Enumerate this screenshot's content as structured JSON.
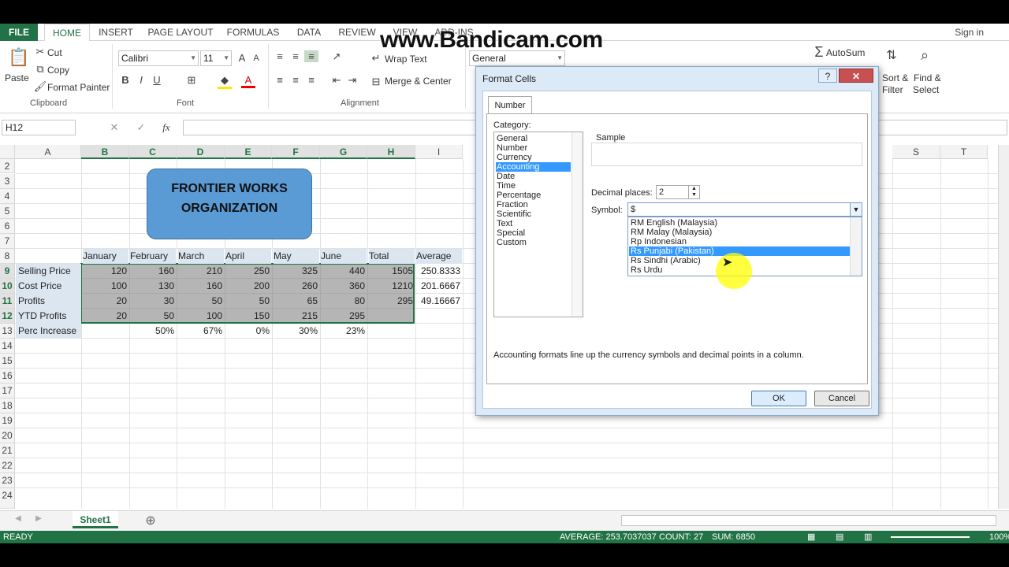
{
  "watermark": "www.Bandicam.com",
  "tabs": [
    "FILE",
    "HOME",
    "INSERT",
    "PAGE LAYOUT",
    "FORMULAS",
    "DATA",
    "REVIEW",
    "VIEW",
    "ADD-INS"
  ],
  "signin": "Sign in",
  "ribbon": {
    "paste": "Paste",
    "cut": "Cut",
    "copy": "Copy",
    "format_painter": "Format Painter",
    "clipboard": "Clipboard",
    "font_name": "Calibri",
    "font_size": "11",
    "font_group": "Font",
    "wrap_text": "Wrap Text",
    "merge_center": "Merge & Center",
    "alignment": "Alignment",
    "number_format": "General",
    "autosum": "AutoSum",
    "sort_filter": "Sort &",
    "sort_filter2": "Filter",
    "find_select": "Find &",
    "find_select2": "Select"
  },
  "namebox": "H12",
  "columns": [
    "A",
    "B",
    "C",
    "D",
    "E",
    "F",
    "G",
    "H",
    "I",
    "S",
    "T"
  ],
  "rows": [
    "2",
    "3",
    "4",
    "5",
    "6",
    "7",
    "8",
    "9",
    "10",
    "11",
    "12",
    "13",
    "14",
    "15",
    "16",
    "17",
    "18",
    "19",
    "20",
    "21",
    "22",
    "23",
    "24"
  ],
  "shape_text": [
    "FRONTIER WORKS",
    "ORGANIZATION"
  ],
  "sheet": {
    "headers": [
      "January",
      "February",
      "March",
      "April",
      "May",
      "June",
      "Total",
      "Average"
    ],
    "rows": [
      {
        "label": "Selling Price",
        "values": [
          "120",
          "160",
          "210",
          "250",
          "325",
          "440",
          "1505",
          "250.8333"
        ]
      },
      {
        "label": "Cost Price",
        "values": [
          "100",
          "130",
          "160",
          "200",
          "260",
          "360",
          "1210",
          "201.6667"
        ]
      },
      {
        "label": "Profits",
        "values": [
          "20",
          "30",
          "50",
          "50",
          "65",
          "80",
          "295",
          "49.16667"
        ]
      },
      {
        "label": "YTD Profits",
        "values": [
          "20",
          "50",
          "100",
          "150",
          "215",
          "295",
          "",
          ""
        ]
      },
      {
        "label": "Perc Increase",
        "values": [
          "",
          "50%",
          "67%",
          "0%",
          "30%",
          "23%",
          "",
          ""
        ]
      }
    ]
  },
  "sheet_tab": "Sheet1",
  "status": {
    "ready": "READY",
    "average": "AVERAGE: 253.7037037",
    "count": "COUNT: 27",
    "sum": "SUM: 6850",
    "zoom": "100%"
  },
  "dialog": {
    "title": "Format Cells",
    "help": "?",
    "tab": "Number",
    "category_label": "Category:",
    "categories": [
      "General",
      "Number",
      "Currency",
      "Accounting",
      "Date",
      "Time",
      "Percentage",
      "Fraction",
      "Scientific",
      "Text",
      "Special",
      "Custom"
    ],
    "selected_category": "Accounting",
    "sample_label": "Sample",
    "decimal_label": "Decimal places:",
    "decimal_value": "2",
    "symbol_label": "Symbol:",
    "symbol_value": "$",
    "symbol_options": [
      "RM English (Malaysia)",
      "RM Malay (Malaysia)",
      "Rp Indonesian",
      "Rs Punjabi (Pakistan)",
      "Rs Sindhi (Arabic)",
      "Rs Urdu"
    ],
    "selected_symbol": "Rs Punjabi (Pakistan)",
    "description": "Accounting formats line up the currency symbols and decimal points in a column.",
    "ok": "OK",
    "cancel": "Cancel"
  }
}
